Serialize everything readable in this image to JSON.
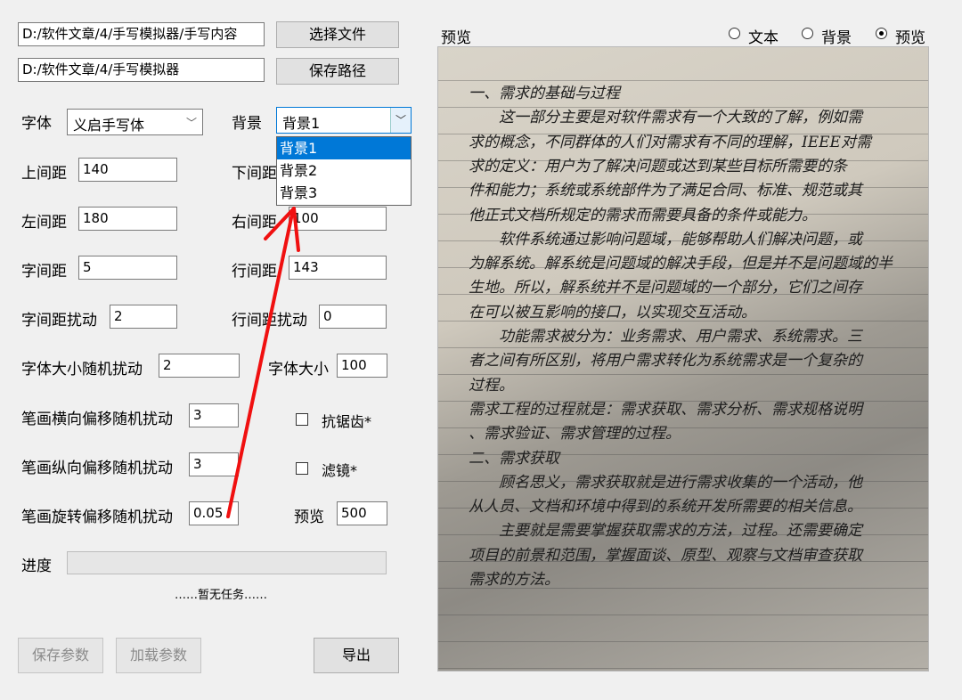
{
  "file": {
    "content_path": "D:/软件文章/4/手写模拟器/手写内容",
    "select_file_label": "选择文件",
    "save_path": "D:/软件文章/4/手写模拟器",
    "save_path_label": "保存路径"
  },
  "font": {
    "label": "字体",
    "value": "义启手写体"
  },
  "background": {
    "label": "背景",
    "value": "背景1",
    "options": [
      "背景1",
      "背景2",
      "背景3"
    ]
  },
  "params": {
    "top_margin": {
      "label": "上间距",
      "value": "140"
    },
    "bottom_margin": {
      "label": "下间距"
    },
    "left_margin": {
      "label": "左间距",
      "value": "180"
    },
    "right_margin": {
      "label": "右间距",
      "value": "100"
    },
    "char_spacing": {
      "label": "字间距",
      "value": "5"
    },
    "line_spacing": {
      "label": "行间距",
      "value": "143"
    },
    "char_spacing_jitter": {
      "label": "字间距扰动",
      "value": "2"
    },
    "line_spacing_jitter": {
      "label": "行间距扰动",
      "value": "0"
    },
    "font_size_jitter": {
      "label": "字体大小随机扰动",
      "value": "2"
    },
    "font_size": {
      "label": "字体大小",
      "value": "100"
    },
    "stroke_h_offset": {
      "label": "笔画横向偏移随机扰动",
      "value": "3"
    },
    "stroke_v_offset": {
      "label": "笔画纵向偏移随机扰动",
      "value": "3"
    },
    "stroke_rotate": {
      "label": "笔画旋转偏移随机扰动",
      "value": "0.05"
    },
    "preview": {
      "label": "预览",
      "value": "500"
    }
  },
  "checks": {
    "antialias": "抗锯齿*",
    "filter": "滤镜*"
  },
  "progress": {
    "label": "进度",
    "status": "……暂无任务……",
    "value": 0
  },
  "buttons": {
    "save_params": "保存参数",
    "load_params": "加载参数",
    "export": "导出"
  },
  "preview_panel": {
    "title": "预览",
    "modes": [
      "文本",
      "背景",
      "预览"
    ],
    "selected_mode": "预览",
    "lines": [
      "一、需求的基础与过程",
      "　　这一部分主要是对软件需求有一个大致的了解，例如需",
      "求的概念，不同群体的人们对需求有不同的理解，IEEE对需",
      "求的定义：用户为了解决问题或达到某些目标所需要的条",
      "件和能力；系统或系统部件为了满足合同、标准、规范或其",
      "他正式文档所规定的需求而需要具备的条件或能力。",
      "　　软件系统通过影响问题域，能够帮助人们解决问题，或",
      "为解系统。解系统是问题域的解决手段，但是并不是问题域的半",
      "生地。所以，解系统并不是问题域的一个部分，它们之间存",
      "在可以被互影响的接口，以实现交互活动。",
      "　　功能需求被分为：业务需求、用户需求、系统需求。三",
      "者之间有所区别，将用户需求转化为系统需求是一个复杂的",
      "过程。",
      "需求工程的过程就是：需求获取、需求分析、需求规格说明",
      "、需求验证、需求管理的过程。",
      "二、需求获取",
      "　　顾名思义，需求获取就是进行需求收集的一个活动，他",
      "从人员、文档和环境中得到的系统开发所需要的相关信息。",
      "　　主要就是需要掌握获取需求的方法，过程。还需要确定",
      "项目的前景和范围，掌握面谈、原型、观察与文档审查获取",
      "需求的方法。"
    ]
  }
}
